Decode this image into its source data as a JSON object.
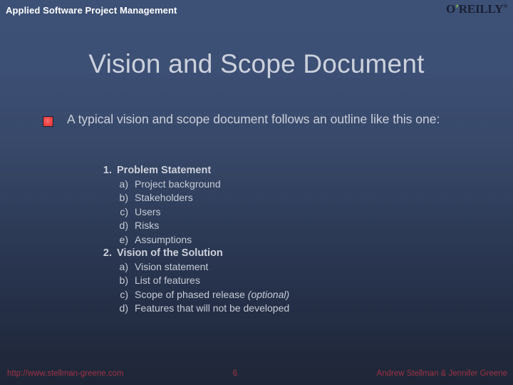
{
  "header": {
    "title": "Applied Software Project Management",
    "logo_text": "O",
    "logo_apostrophe": "’",
    "logo_rest": "REILLY",
    "logo_registered": "®"
  },
  "slide": {
    "title": "Vision and Scope Document",
    "intro_bullet": "A typical vision and scope document follows an outline like this one:",
    "outline": [
      {
        "number": "1.",
        "label": "Problem Statement",
        "subitems": [
          {
            "marker": "a)",
            "text": "Project background"
          },
          {
            "marker": "b)",
            "text": "Stakeholders"
          },
          {
            "marker": "c)",
            "text": "Users"
          },
          {
            "marker": "d)",
            "text": "Risks"
          },
          {
            "marker": "e)",
            "text": "Assumptions"
          }
        ]
      },
      {
        "number": "2.",
        "label": "Vision of the Solution",
        "subitems": [
          {
            "marker": "a)",
            "text": "Vision statement"
          },
          {
            "marker": "b)",
            "text": "List of features"
          },
          {
            "marker": "c)",
            "text": "Scope of phased release ",
            "italic_suffix": "(optional)"
          },
          {
            "marker": "d)",
            "text": "Features that will not be developed"
          }
        ]
      }
    ]
  },
  "footer": {
    "url": "http://www.stellman-greene.com",
    "page_number": "6",
    "authors": "Andrew Stellman & Jennifer Greene"
  },
  "colors": {
    "background_top": "#3d5177",
    "background_bottom": "#1e2636",
    "title_text": "#ccd1dc",
    "body_text": "#ccd0da",
    "bullet_red": "#f24a4a",
    "footer_red": "#9e3245",
    "logo_navy": "#1a1f33",
    "logo_green": "#8fbf3f"
  }
}
